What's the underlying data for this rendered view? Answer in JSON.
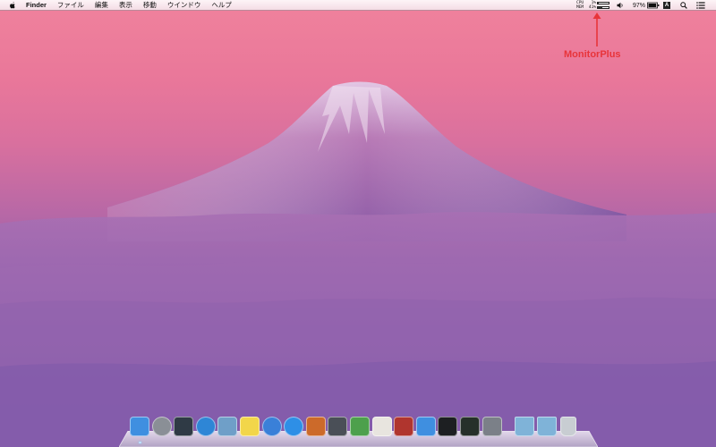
{
  "menubar": {
    "apple_icon": "apple-icon",
    "items": [
      "Finder",
      "ファイル",
      "編集",
      "表示",
      "移動",
      "ウインドウ",
      "ヘルプ"
    ]
  },
  "monitor": {
    "cpu_label": "CPU",
    "cpu_value": "1%",
    "cpu_fraction": 0.01,
    "mem_label": "MEM",
    "mem_value": "41%",
    "mem_fraction": 0.41
  },
  "status": {
    "volume_icon": "speaker-icon",
    "battery_text": "97%",
    "battery_fraction": 0.97,
    "input_source": "A",
    "search_icon": "spotlight-search-icon",
    "notification_icon": "notification-center-icon"
  },
  "annotation": {
    "label": "MonitorPlus",
    "color": "#e8343a"
  },
  "dock": {
    "apps": [
      {
        "name": "finder-icon",
        "color": "#3f8fe0",
        "running": true
      },
      {
        "name": "launchpad-icon",
        "color": "#8a8f96",
        "running": false
      },
      {
        "name": "mission-control-icon",
        "color": "#2f3a45",
        "running": false
      },
      {
        "name": "safari-icon",
        "color": "#2e86d6",
        "running": false
      },
      {
        "name": "preview-icon",
        "color": "#6f9fc8",
        "running": false
      },
      {
        "name": "stickies-icon",
        "color": "#f2d64a",
        "running": false
      },
      {
        "name": "itunes-icon",
        "color": "#3a80d8",
        "running": false
      },
      {
        "name": "app-store-icon",
        "color": "#2e8fe6",
        "running": false
      },
      {
        "name": "keynote-icon",
        "color": "#cc6a2a",
        "running": false
      },
      {
        "name": "system-pen-icon",
        "color": "#4a4f57",
        "running": false
      },
      {
        "name": "numbers-icon",
        "color": "#4da04c",
        "running": false
      },
      {
        "name": "textedit-icon",
        "color": "#e8e5df",
        "running": false
      },
      {
        "name": "dictionary-icon",
        "color": "#b0352e",
        "running": false
      },
      {
        "name": "xcode-icon",
        "color": "#3f8fe0",
        "running": false
      },
      {
        "name": "terminal-icon",
        "color": "#1d1f22",
        "running": false
      },
      {
        "name": "activity-monitor-icon",
        "color": "#26302a",
        "running": false
      },
      {
        "name": "system-preferences-icon",
        "color": "#7b8088",
        "running": false
      },
      {
        "name": "applications-folder-icon",
        "color": "#7fb3d8",
        "running": false
      },
      {
        "name": "downloads-folder-icon",
        "color": "#7fb3d8",
        "running": false
      },
      {
        "name": "trash-icon",
        "color": "#c8cdd2",
        "running": false
      }
    ]
  }
}
